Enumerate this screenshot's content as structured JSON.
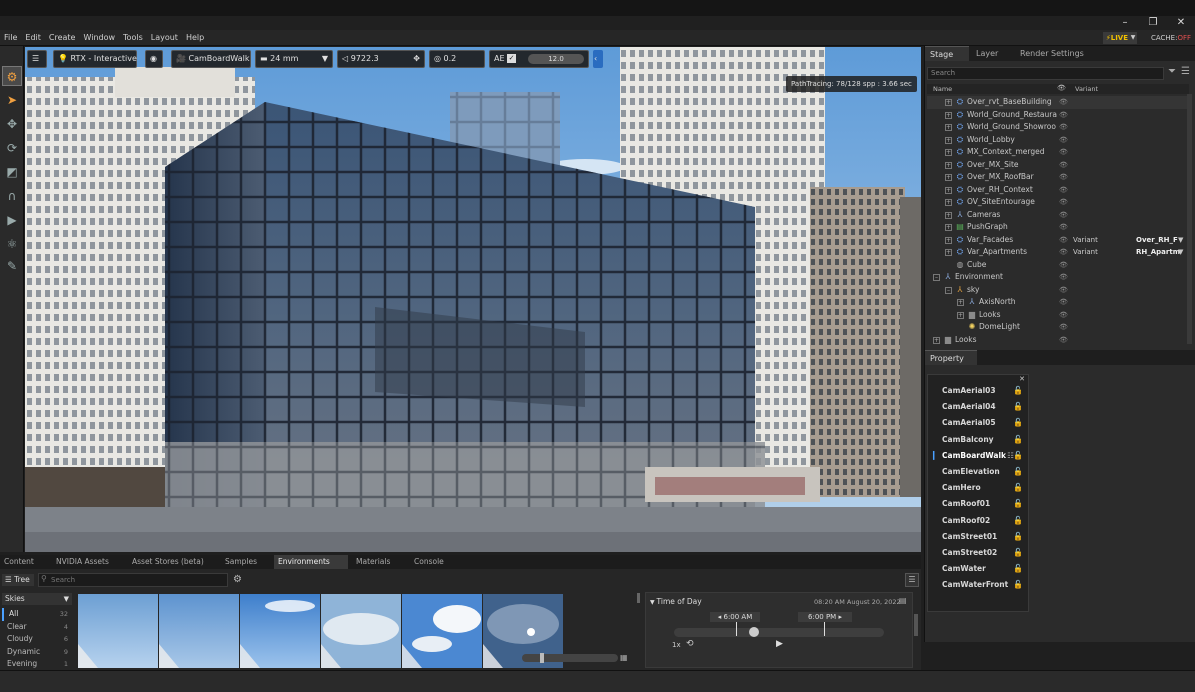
{
  "menubar": {
    "items": [
      "File",
      "Edit",
      "Create",
      "Window",
      "Tools",
      "Layout",
      "Help"
    ]
  },
  "window_controls": {
    "minimize": "–",
    "maximize": "❐",
    "close": "✕"
  },
  "status_indicators": {
    "live": "LIVE",
    "cache_label": "CACHE:",
    "cache_state": "OFF"
  },
  "viewport_toolbar": {
    "renderer": "RTX - Interactive",
    "camera": "CamBoardWalk",
    "focal_length": "24 mm",
    "focus_distance": "9722.3",
    "aperture": "0.2",
    "ae_label": "AE",
    "exposure": "12.0"
  },
  "viewport_status": "PathTracing: 78/128 spp : 3.66 sec",
  "stage": {
    "tabs": [
      "Stage",
      "Layer",
      "Render Settings"
    ],
    "search_placeholder": "Search",
    "col_name": "Name",
    "col_variant": "Variant",
    "tree": [
      {
        "label": "Over_rvt_BaseBuilding",
        "depth": 1,
        "exp": "+",
        "icon": "prim"
      },
      {
        "label": "World_Ground_Restaura",
        "depth": 1,
        "exp": "+",
        "icon": "prim"
      },
      {
        "label": "World_Ground_Showroo",
        "depth": 1,
        "exp": "+",
        "icon": "prim"
      },
      {
        "label": "World_Lobby",
        "depth": 1,
        "exp": "+",
        "icon": "prim"
      },
      {
        "label": "MX_Context_merged",
        "depth": 1,
        "exp": "+",
        "icon": "prim"
      },
      {
        "label": "Over_MX_Site",
        "depth": 1,
        "exp": "+",
        "icon": "prim"
      },
      {
        "label": "Over_MX_RoofBar",
        "depth": 1,
        "exp": "+",
        "icon": "prim"
      },
      {
        "label": "Over_RH_Context",
        "depth": 1,
        "exp": "+",
        "icon": "prim"
      },
      {
        "label": "OV_SiteEntourage",
        "depth": 1,
        "exp": "+",
        "icon": "prim"
      },
      {
        "label": "Cameras",
        "depth": 1,
        "exp": "+",
        "icon": "xform"
      },
      {
        "label": "PushGraph",
        "depth": 1,
        "exp": "+",
        "icon": "graph"
      },
      {
        "label": "Var_Facades",
        "depth": 1,
        "exp": "+",
        "icon": "prim",
        "variant": "Variant",
        "variant_value": "Over_RH_F"
      },
      {
        "label": "Var_Apartments",
        "depth": 1,
        "exp": "+",
        "icon": "prim",
        "variant": "Variant",
        "variant_value": "RH_Apartm"
      },
      {
        "label": "Cube",
        "depth": 1,
        "exp": "",
        "icon": "cube"
      },
      {
        "label": "Environment",
        "depth": 0,
        "exp": "–",
        "icon": "xform"
      },
      {
        "label": "sky",
        "depth": 1,
        "exp": "–",
        "icon": "xform-orange"
      },
      {
        "label": "AxisNorth",
        "depth": 2,
        "exp": "+",
        "icon": "xform"
      },
      {
        "label": "Looks",
        "depth": 2,
        "exp": "+",
        "icon": "folder"
      },
      {
        "label": "DomeLight",
        "depth": 2,
        "exp": "",
        "icon": "light"
      },
      {
        "label": "Looks",
        "depth": 0,
        "exp": "+",
        "icon": "folder"
      }
    ]
  },
  "property": {
    "tab": "Property",
    "cameras": [
      "CamAerial03",
      "CamAerial04",
      "CamAerial05",
      "CamBalcony",
      "CamBoardWalk",
      "CamElevation",
      "CamHero",
      "CamRoof01",
      "CamRoof02",
      "CamStreet01",
      "CamStreet02",
      "CamWater",
      "CamWaterFront"
    ],
    "active_camera": "CamBoardWalk"
  },
  "bottom": {
    "tabs": [
      "Content",
      "NVIDIA Assets",
      "Asset Stores (beta)",
      "Samples",
      "Environments",
      "Materials",
      "Console"
    ],
    "active_tab": "Environments",
    "tree_button": "Tree",
    "search_placeholder": "Search",
    "category_header": "Skies",
    "categories": [
      {
        "name": "All",
        "count": "32"
      },
      {
        "name": "Clear",
        "count": "4"
      },
      {
        "name": "Cloudy",
        "count": "6"
      },
      {
        "name": "Dynamic",
        "count": "9"
      },
      {
        "name": "Evening",
        "count": "1"
      }
    ],
    "time_of_day": {
      "title": "Time of Day",
      "current": "08:20 AM  August 20, 2022",
      "sunrise": "6:00 AM",
      "sunset": "6:00 PM",
      "speed": "1x"
    }
  },
  "colors": {
    "accent": "#f0a040",
    "live": "#f0c000",
    "cache_off": "#e05050",
    "prim_icon": "#6ea0e8"
  }
}
